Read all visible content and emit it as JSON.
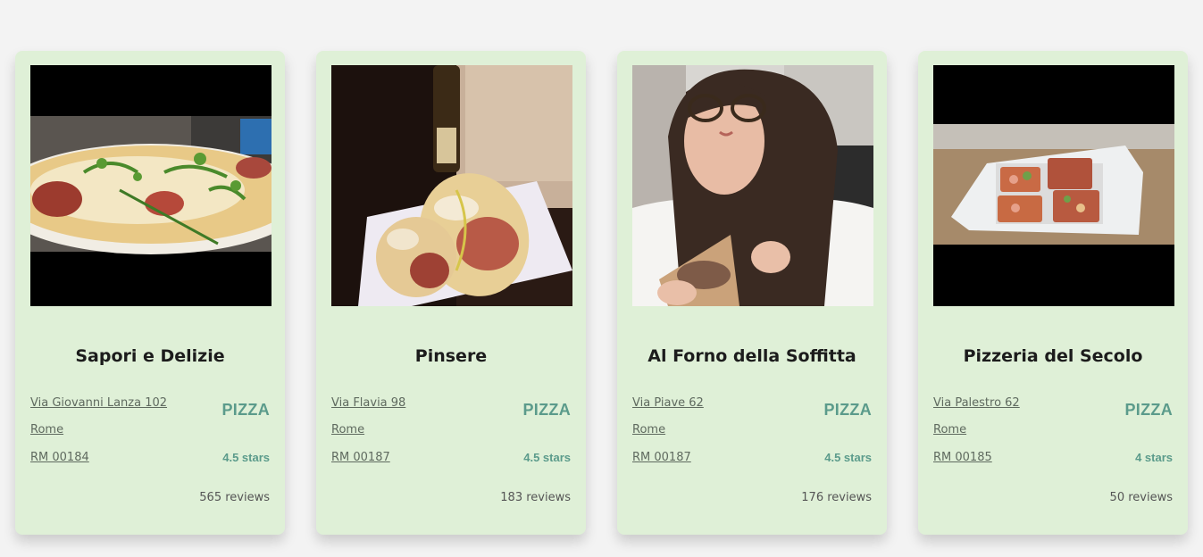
{
  "restaurants": [
    {
      "name": "Sapori e Delizie",
      "photo": "pizza-photo",
      "address_line1": "Via Giovanni Lanza 102",
      "address_line2": "Rome",
      "address_line3": "RM 00184",
      "category": "PIZZA",
      "rating": "4.5 stars",
      "reviews": "565 reviews"
    },
    {
      "name": "Pinsere",
      "photo": "pinsa-beer-photo",
      "address_line1": "Via Flavia 98",
      "address_line2": "Rome",
      "address_line3": "RM 00187",
      "category": "PIZZA",
      "rating": "4.5 stars",
      "reviews": "183 reviews"
    },
    {
      "name": "Al Forno della Soffitta",
      "photo": "woman-eating-pizza-photo",
      "address_line1": "Via Piave 62",
      "address_line2": "Rome",
      "address_line3": "RM 00187",
      "category": "PIZZA",
      "rating": "4.5 stars",
      "reviews": "176 reviews"
    },
    {
      "name": "Pizzeria del Secolo",
      "photo": "pizza-slices-tray-photo",
      "address_line1": "Via Palestro 62",
      "address_line2": "Rome",
      "address_line3": "RM 00185",
      "category": "PIZZA",
      "rating": "4 stars",
      "reviews": "50 reviews"
    }
  ],
  "colors": {
    "page_background": "#f3f3f3",
    "card_background": "#dff0d7",
    "accent": "#5b9b8b"
  }
}
